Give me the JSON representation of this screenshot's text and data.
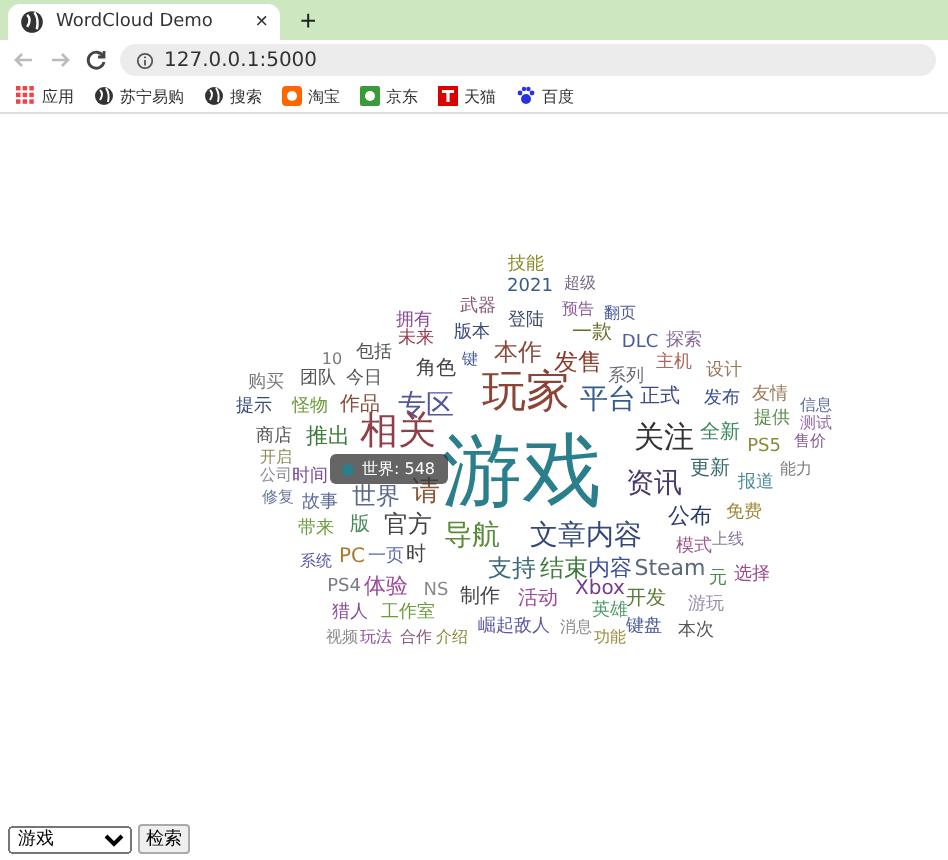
{
  "browser": {
    "tab": {
      "title": "WordCloud Demo",
      "close": "×"
    },
    "new_tab": "+",
    "address": "127.0.0.1:5000",
    "bookmarks": [
      {
        "label": "应用"
      },
      {
        "label": "苏宁易购"
      },
      {
        "label": "搜索"
      },
      {
        "label": "淘宝"
      },
      {
        "label": "京东"
      },
      {
        "label": "天猫"
      },
      {
        "label": "百度"
      }
    ]
  },
  "wordcloud": {
    "words": [
      {
        "text": "技能",
        "color": "#8a8a2a"
      },
      {
        "text": "2021",
        "color": "#3a5a8a"
      },
      {
        "text": "超级",
        "color": "#7a6a8a"
      },
      {
        "text": "拥有",
        "color": "#8a4a9a"
      },
      {
        "text": "武器",
        "color": "#8a5a7a"
      },
      {
        "text": "登陆",
        "color": "#3a4a6a"
      },
      {
        "text": "预告",
        "color": "#8a5a9a"
      },
      {
        "text": "翻页",
        "color": "#4a5a9a"
      },
      {
        "text": "未来",
        "color": "#9a3a4a"
      },
      {
        "text": "版本",
        "color": "#3a4a7a"
      },
      {
        "text": "一款",
        "color": "#6a6a2a"
      },
      {
        "text": "DLC",
        "color": "#4a5a9a"
      },
      {
        "text": "探索",
        "color": "#8a6a9a"
      },
      {
        "text": "10",
        "color": "#7a7a7a"
      },
      {
        "text": "包括",
        "color": "#555555"
      },
      {
        "text": "键",
        "color": "#4a5a9a"
      },
      {
        "text": "本作",
        "color": "#8a4a3a"
      },
      {
        "text": "发售",
        "color": "#8a3a2a"
      },
      {
        "text": "主机",
        "color": "#aa6a5a"
      },
      {
        "text": "购买",
        "color": "#7a7a7a"
      },
      {
        "text": "团队",
        "color": "#555555"
      },
      {
        "text": "今日",
        "color": "#555555"
      },
      {
        "text": "角色",
        "color": "#444444"
      },
      {
        "text": "系列",
        "color": "#6a6a7a"
      },
      {
        "text": "设计",
        "color": "#9a7a5a"
      },
      {
        "text": "提示",
        "color": "#3a4a7a"
      },
      {
        "text": "怪物",
        "color": "#6a9a3a"
      },
      {
        "text": "作品",
        "color": "#8a4a3a"
      },
      {
        "text": "专区",
        "color": "#55559a"
      },
      {
        "text": "玩家",
        "color": "#8b4536"
      },
      {
        "text": "平台",
        "color": "#365a8c"
      },
      {
        "text": "正式",
        "color": "#3a4a8a"
      },
      {
        "text": "发布",
        "color": "#3a4a9a"
      },
      {
        "text": "友情",
        "color": "#9a7a5a"
      },
      {
        "text": "信息",
        "color": "#5a6a9a"
      },
      {
        "text": "提供",
        "color": "#5a8a4a"
      },
      {
        "text": "测试",
        "color": "#9a6aaa"
      },
      {
        "text": "商店",
        "color": "#555555"
      },
      {
        "text": "推出",
        "color": "#3a7a3a"
      },
      {
        "text": "相关",
        "color": "#8f3f48"
      },
      {
        "text": "开启",
        "color": "#8a8a5a"
      },
      {
        "text": "公司",
        "color": "#8a8a9a"
      },
      {
        "text": "时间",
        "color": "#7a4a9a"
      },
      {
        "text": "修复",
        "color": "#6a7a9a"
      },
      {
        "text": "故事",
        "color": "#5a6a9a"
      },
      {
        "text": "世界",
        "color": "#5a6a8a"
      },
      {
        "text": "请",
        "color": "#8a5a3a"
      },
      {
        "text": "游戏",
        "color": "#2b7f8c"
      },
      {
        "text": "关注",
        "color": "#333333"
      },
      {
        "text": "全新",
        "color": "#3a8a5a"
      },
      {
        "text": "PS5",
        "color": "#8a8a3a"
      },
      {
        "text": "售价",
        "color": "#8a5a9a"
      },
      {
        "text": "资讯",
        "color": "#473867"
      },
      {
        "text": "更新",
        "color": "#3a6a6a"
      },
      {
        "text": "报道",
        "color": "#4a8a9a"
      },
      {
        "text": "能力",
        "color": "#7a7a7a"
      },
      {
        "text": "带来",
        "color": "#6a9a3a"
      },
      {
        "text": "版",
        "color": "#4a8a5a"
      },
      {
        "text": "官方",
        "color": "#444444"
      },
      {
        "text": "导航",
        "color": "#5a8a3a"
      },
      {
        "text": "文章内容",
        "color": "#36477a"
      },
      {
        "text": "公布",
        "color": "#2a3a6a"
      },
      {
        "text": "免费",
        "color": "#9a8a3a"
      },
      {
        "text": "模式",
        "color": "#9a5a8a"
      },
      {
        "text": "上线",
        "color": "#8a7a9a"
      },
      {
        "text": "系统",
        "color": "#5a5aaa"
      },
      {
        "text": "PC",
        "color": "#aa7a2a"
      },
      {
        "text": "一页",
        "color": "#5a6aaa"
      },
      {
        "text": "时",
        "color": "#444444"
      },
      {
        "text": "支持",
        "color": "#3a6a7a"
      },
      {
        "text": "结束",
        "color": "#3a7a3a"
      },
      {
        "text": "内容",
        "color": "#3a4a9a"
      },
      {
        "text": "Steam",
        "color": "#5a6a7a"
      },
      {
        "text": "元",
        "color": "#4a8a4a"
      },
      {
        "text": "选择",
        "color": "#9a4a8a"
      },
      {
        "text": "PS4",
        "color": "#7a7a8a"
      },
      {
        "text": "体验",
        "color": "#9a4a9a"
      },
      {
        "text": "NS",
        "color": "#8a8a8a"
      },
      {
        "text": "制作",
        "color": "#444444"
      },
      {
        "text": "活动",
        "color": "#9a4a9a"
      },
      {
        "text": "Xbox",
        "color": "#7a3a8a"
      },
      {
        "text": "开发",
        "color": "#5a7a3a"
      },
      {
        "text": "游玩",
        "color": "#9a8aaa"
      },
      {
        "text": "猎人",
        "color": "#8a4a9a"
      },
      {
        "text": "工作室",
        "color": "#6a9a3a"
      },
      {
        "text": "英雄",
        "color": "#4a9a6a"
      },
      {
        "text": "视频",
        "color": "#8a8a8a"
      },
      {
        "text": "玩法",
        "color": "#8a4a9a"
      },
      {
        "text": "合作",
        "color": "#8a5a7a"
      },
      {
        "text": "介绍",
        "color": "#8a8a3a"
      },
      {
        "text": "崛起敌人",
        "color": "#5a5aaa"
      },
      {
        "text": "消息",
        "color": "#8a8a8a"
      },
      {
        "text": "功能",
        "color": "#9a8a3a"
      },
      {
        "text": "键盘",
        "color": "#4a5a9a"
      },
      {
        "text": "本次",
        "color": "#555555"
      }
    ],
    "tooltip": {
      "label": "世界: 548"
    }
  },
  "search_form": {
    "select": {
      "value": "游戏"
    },
    "button": "检索"
  }
}
